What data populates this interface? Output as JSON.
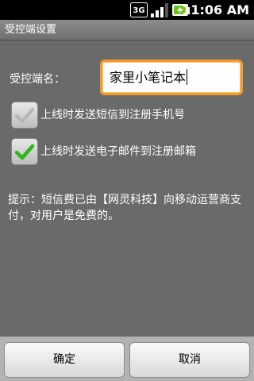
{
  "status_bar": {
    "network_type": "3G",
    "time": "11:06 AM",
    "signal_level": 0.8,
    "battery_charging": true
  },
  "window": {
    "title": "受控端设置"
  },
  "form": {
    "name_label": "受控端名：",
    "name_value": "家里小笔记本",
    "sms_option": {
      "label": "上线时发送短信到注册手机号",
      "checked": false
    },
    "email_option": {
      "label": "上线时发送电子邮件到注册邮箱",
      "checked": true
    },
    "tip": "提示：短信费已由【网灵科技】向移动运营商支付，对用户是免费的。"
  },
  "buttons": {
    "ok_label": "确定",
    "cancel_label": "取消"
  },
  "colors": {
    "focus_border": "#f39c2d",
    "check_green": "#2fb51a",
    "check_gray": "#b5b5b5",
    "battery_green": "#6ac21c"
  }
}
